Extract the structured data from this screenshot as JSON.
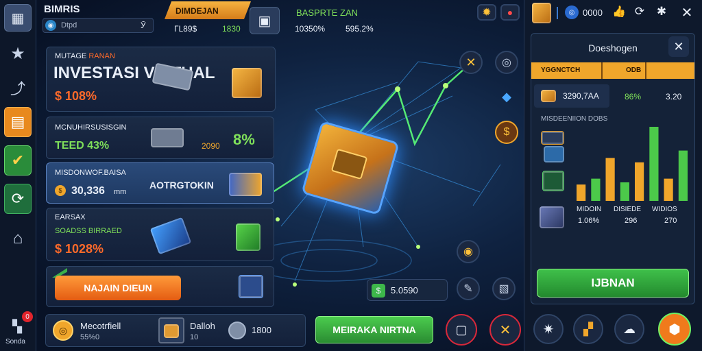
{
  "topbar": {
    "title": "BIMRIS",
    "selector_value": "Dtpd",
    "selector_arrow": "Ӯ",
    "tab1_label": "DIMDEJAN",
    "tab1_stat1": "ГL89$",
    "tab1_stat2": "1830",
    "tab2_label": "BASPRTE ZAN",
    "tab2_stat1": "10350%",
    "tab2_stat2": "595.2%",
    "currency_value": "0000"
  },
  "cards": [
    {
      "subtitle": "MUTAGE",
      "subtitle_hl": "RANAN",
      "title": "INVESTASI VIRTUAL",
      "value": "$ 108%"
    },
    {
      "subtitle": "MCNUHIRSUSISGIN",
      "value": "TEED 43%",
      "small_value": "2090",
      "percent": "8%"
    },
    {
      "subtitle": "MISDONWOF.BAISA",
      "value": "30,336",
      "unit": "mm",
      "side_label": "AOTRGTOKIN"
    },
    {
      "subtitle": "EARSAX",
      "subtitle2": "SOADSS BIRRAED",
      "value": "$ 1028%"
    }
  ],
  "cta_orange": "NAJAIN DIEUN",
  "center_chip": "5.0590",
  "right_panel": {
    "title": "Doeshogen",
    "header_col1": "YGGNCTCH",
    "header_col2": "ODB",
    "row_value": "3290,7AA",
    "row_percent": "86%",
    "row_count": "3.20",
    "chart_title": "MISDEENIION DOBS",
    "col_labels": [
      "MIDOIN",
      "DISIEDE",
      "WIDIOS"
    ],
    "col_values": [
      "1.06%",
      "296",
      "270"
    ],
    "button": "IJBNAN"
  },
  "chart_data": {
    "type": "bar",
    "categories": [
      "1",
      "2",
      "3",
      "4",
      "5",
      "6",
      "7",
      "8"
    ],
    "values": [
      22,
      30,
      58,
      25,
      52,
      100,
      30,
      68
    ]
  },
  "bottom": {
    "slot1_title": "Mecotrfiell",
    "slot1_value": "55%0",
    "slot2_title": "Dalloh",
    "slot2_value": "10",
    "slot3_value": "1800",
    "button": "MEIRAKA NIRTNA"
  },
  "left_nav": {
    "badge": "0",
    "label": "Sonda"
  },
  "colors": {
    "orange": "#f0a62b",
    "green": "#4cc94a",
    "panel": "#16243c"
  }
}
